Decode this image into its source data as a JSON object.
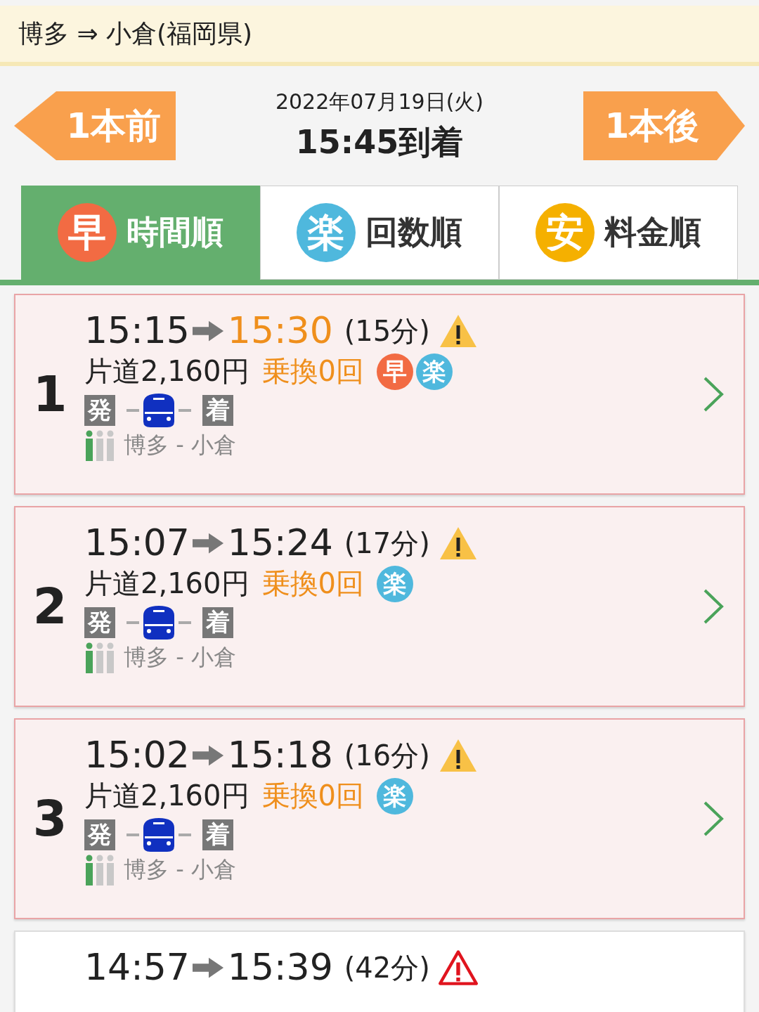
{
  "route": {
    "title": "博多 ⇒ 小倉(福岡県)"
  },
  "nav": {
    "prev": "1本前",
    "date": "2022年07月19日(火)",
    "time": "15:45到着",
    "next": "1本後"
  },
  "tabs": [
    {
      "badge": "早",
      "color": "#f26b43",
      "label": "時間順",
      "selected": true
    },
    {
      "badge": "楽",
      "color": "#4fb8dd",
      "label": "回数順",
      "selected": false
    },
    {
      "badge": "安",
      "color": "#f5b000",
      "label": "料金順",
      "selected": false
    }
  ],
  "results": [
    {
      "index": "1",
      "depart": "15:15",
      "arrive": "15:30",
      "arrive_highlight": true,
      "duration": "(15分)",
      "warning": {
        "kind": "caution"
      },
      "highlighted": true,
      "fare": "片道2,160円",
      "transfers": "乗換0回",
      "badges": [
        {
          "text": "早",
          "color": "#f26b43"
        },
        {
          "text": "楽",
          "color": "#4fb8dd"
        }
      ],
      "from_tag": "発",
      "to_tag": "着",
      "stations": "博多 - 小倉"
    },
    {
      "index": "2",
      "depart": "15:07",
      "arrive": "15:24",
      "arrive_highlight": false,
      "duration": "(17分)",
      "warning": {
        "kind": "caution"
      },
      "highlighted": true,
      "fare": "片道2,160円",
      "transfers": "乗換0回",
      "badges": [
        {
          "text": "楽",
          "color": "#4fb8dd"
        }
      ],
      "from_tag": "発",
      "to_tag": "着",
      "stations": "博多 - 小倉"
    },
    {
      "index": "3",
      "depart": "15:02",
      "arrive": "15:18",
      "arrive_highlight": false,
      "duration": "(16分)",
      "warning": {
        "kind": "caution"
      },
      "highlighted": true,
      "fare": "片道2,160円",
      "transfers": "乗換0回",
      "badges": [
        {
          "text": "楽",
          "color": "#4fb8dd"
        }
      ],
      "from_tag": "発",
      "to_tag": "着",
      "stations": "博多 - 小倉"
    },
    {
      "depart": "14:57",
      "arrive": "15:39",
      "arrive_highlight": false,
      "duration": "(42分)",
      "warning": {
        "kind": "alert"
      },
      "highlighted": false
    }
  ]
}
